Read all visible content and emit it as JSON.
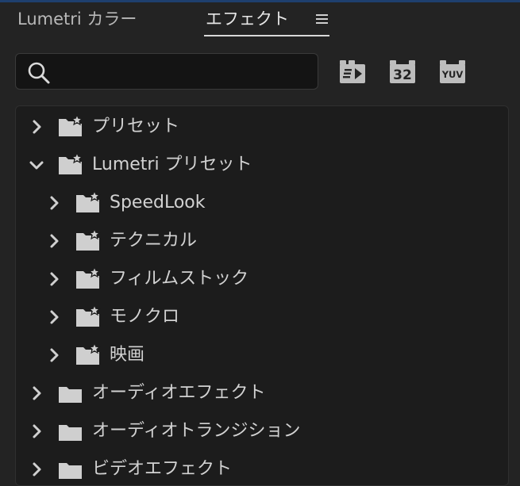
{
  "tabs": [
    {
      "label": "Lumetri カラー"
    },
    {
      "label": "エフェクト"
    }
  ],
  "search": {
    "value": "",
    "placeholder": ""
  },
  "filters": {
    "accelerated_icon": "accelerated-effects-icon",
    "bit32_label": "32",
    "yuv_label": "YUV"
  },
  "tree": {
    "items": [
      {
        "label": "プリセット",
        "expanded": false,
        "icon": "preset-folder-icon"
      },
      {
        "label": "Lumetri プリセット",
        "expanded": true,
        "icon": "preset-folder-icon"
      },
      {
        "label": "SpeedLook",
        "expanded": false,
        "icon": "preset-folder-icon"
      },
      {
        "label": "テクニカル",
        "expanded": false,
        "icon": "preset-folder-icon"
      },
      {
        "label": "フィルムストック",
        "expanded": false,
        "icon": "preset-folder-icon"
      },
      {
        "label": "モノクロ",
        "expanded": false,
        "icon": "preset-folder-icon"
      },
      {
        "label": "映画",
        "expanded": false,
        "icon": "preset-folder-icon"
      },
      {
        "label": "オーディオエフェクト",
        "expanded": false,
        "icon": "folder-icon"
      },
      {
        "label": "オーディオトランジション",
        "expanded": false,
        "icon": "folder-icon"
      },
      {
        "label": "ビデオエフェクト",
        "expanded": false,
        "icon": "folder-icon"
      }
    ]
  },
  "colors": {
    "background": "#232323",
    "panel": "#1c1c1c",
    "text": "#d2d2d2",
    "accent_edge": "#1e3f6e"
  }
}
